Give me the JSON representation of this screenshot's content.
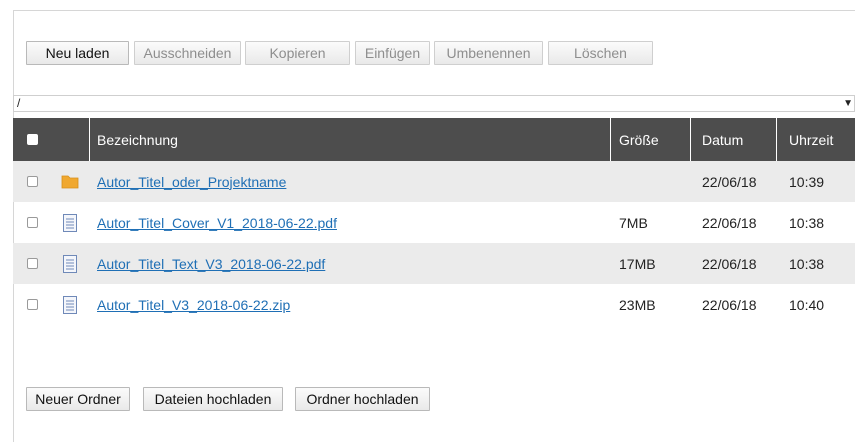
{
  "toolbar": {
    "buttons": [
      {
        "label": "Neu laden",
        "enabled": true
      },
      {
        "label": "Ausschneiden",
        "enabled": false
      },
      {
        "label": "Kopieren",
        "enabled": false
      },
      {
        "label": "Einfügen",
        "enabled": false
      },
      {
        "label": "Umbenennen",
        "enabled": false
      },
      {
        "label": "Löschen",
        "enabled": false
      }
    ]
  },
  "path": {
    "value": "/",
    "caret": "▼"
  },
  "table": {
    "headers": {
      "name": "Bezeichnung",
      "size": "Größe",
      "date": "Datum",
      "time": "Uhrzeit"
    },
    "rows": [
      {
        "type": "folder",
        "name": "Autor_Titel_oder_Projektname",
        "size": "",
        "date": "22/06/18",
        "time": "10:39"
      },
      {
        "type": "file",
        "name": "Autor_Titel_Cover_V1_2018-06-22.pdf",
        "size": "7MB",
        "date": "22/06/18",
        "time": "10:38"
      },
      {
        "type": "file",
        "name": "Autor_Titel_Text_V3_2018-06-22.pdf",
        "size": "17MB",
        "date": "22/06/18",
        "time": "10:38"
      },
      {
        "type": "file",
        "name": "Autor_Titel_V3_2018-06-22.zip",
        "size": "23MB",
        "date": "22/06/18",
        "time": "10:40"
      }
    ]
  },
  "bottom": {
    "new_folder": "Neuer Ordner",
    "upload_files": "Dateien hochladen",
    "upload_folder": "Ordner hochladen"
  },
  "colors": {
    "header_bg": "#4d4d4d",
    "row_alt": "#ebebeb",
    "link": "#1f6fb5",
    "folder": "#f0a830",
    "doc": "#6f89b8"
  }
}
